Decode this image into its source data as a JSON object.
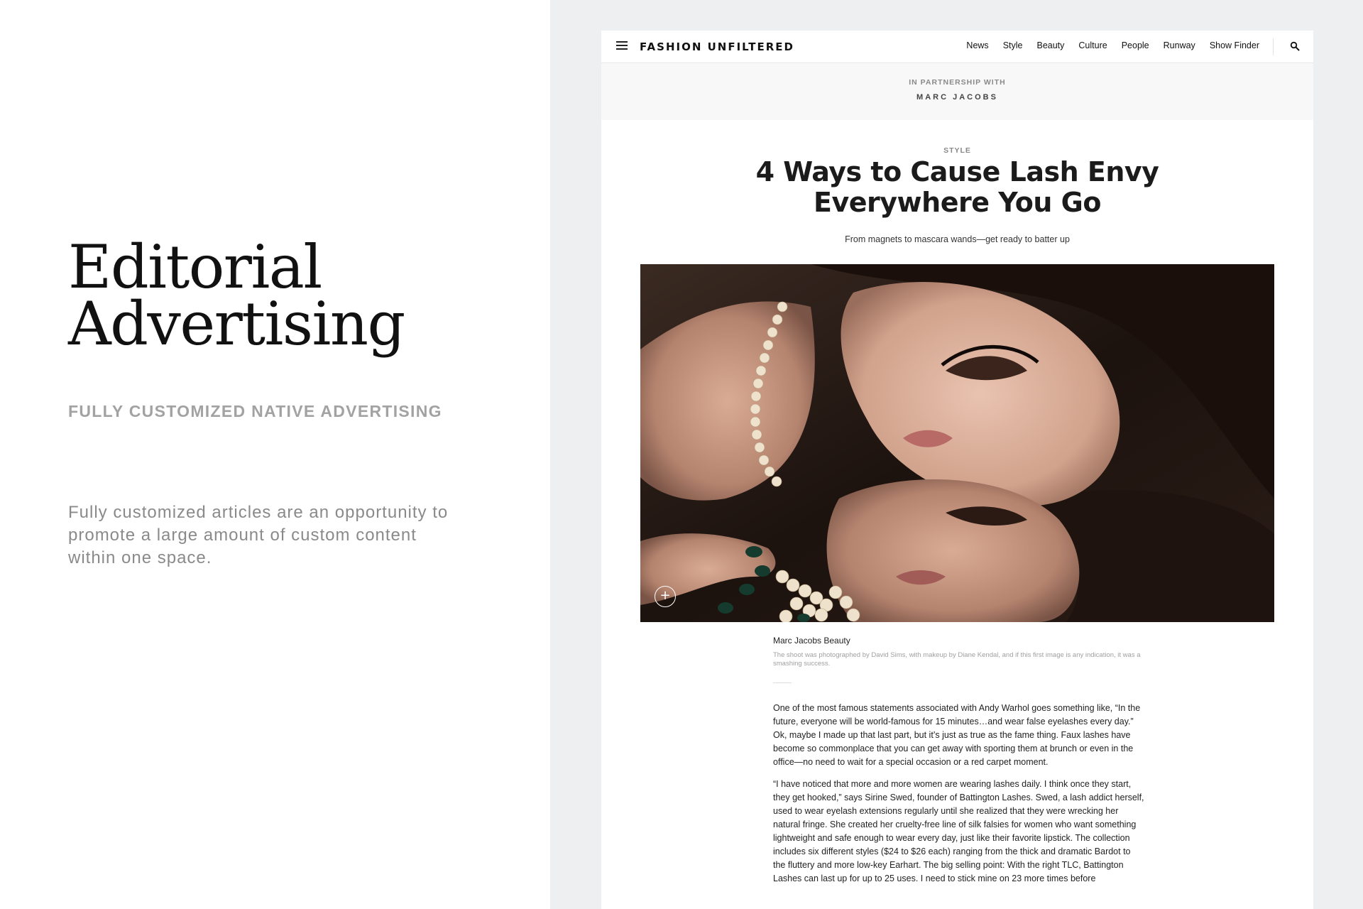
{
  "promo": {
    "title_line1": "Editorial",
    "title_line2": "Advertising",
    "subtitle": "FULLY CUSTOMIZED NATIVE ADVERTISING",
    "description": "Fully customized articles are an opportunity to promote a large amount of custom content within one space."
  },
  "site": {
    "logo": "FASHION UNFILTERED",
    "nav": [
      "News",
      "Style",
      "Beauty",
      "Culture",
      "People",
      "Runway",
      "Show Finder"
    ],
    "icons": {
      "menu": "hamburger-menu-icon",
      "search": "search-icon",
      "expand": "plus-circle-icon"
    }
  },
  "partner": {
    "label": "IN PARTNERSHIP WITH",
    "brand": "MARC JACOBS"
  },
  "article": {
    "category": "STYLE",
    "headline": "4 Ways to Cause Lash Envy Everywhere You Go",
    "dek": "From magnets to mascara wands—get ready to batter up",
    "caption_title": "Marc Jacobs Beauty",
    "caption_text": "The shoot was photographed by David Sims, with makeup by Diane Kendal, and if this first image is any indication, it was a smashing success.",
    "paragraphs": [
      "One of the most famous statements associated with Andy Warhol goes something like, “In the future, everyone will be world-famous for 15 minutes…and wear false eyelashes every day.” Ok, maybe I made up that last part, but it’s just as true as the fame thing. Faux lashes have become so commonplace that you can get away with sporting them at brunch or even in the office—no need to wait for a special occasion or a red carpet moment.",
      "“I have noticed that more and more women are wearing lashes daily. I think once they start, they get hooked,” says Sirine Swed, founder of Battington Lashes. Swed, a lash addict herself, used to wear eyelash extensions regularly until she realized that they were wrecking her natural fringe. She created her cruelty-free line of silk falsies for women who want something lightweight and safe enough to wear every day, just like their favorite lipstick. The collection includes six different styles ($24 to $26 each) ranging from the thick and dramatic Bardot to the fluttery and more low-key Earhart. The big selling point: With the right TLC, Battington Lashes can last up for up to 25 uses. I need to stick mine on 23 more times before"
    ]
  },
  "colors": {
    "backdrop": "#eeeff1",
    "partner_bar": "#f8f8f8",
    "muted_text": "#a2a2a2"
  }
}
